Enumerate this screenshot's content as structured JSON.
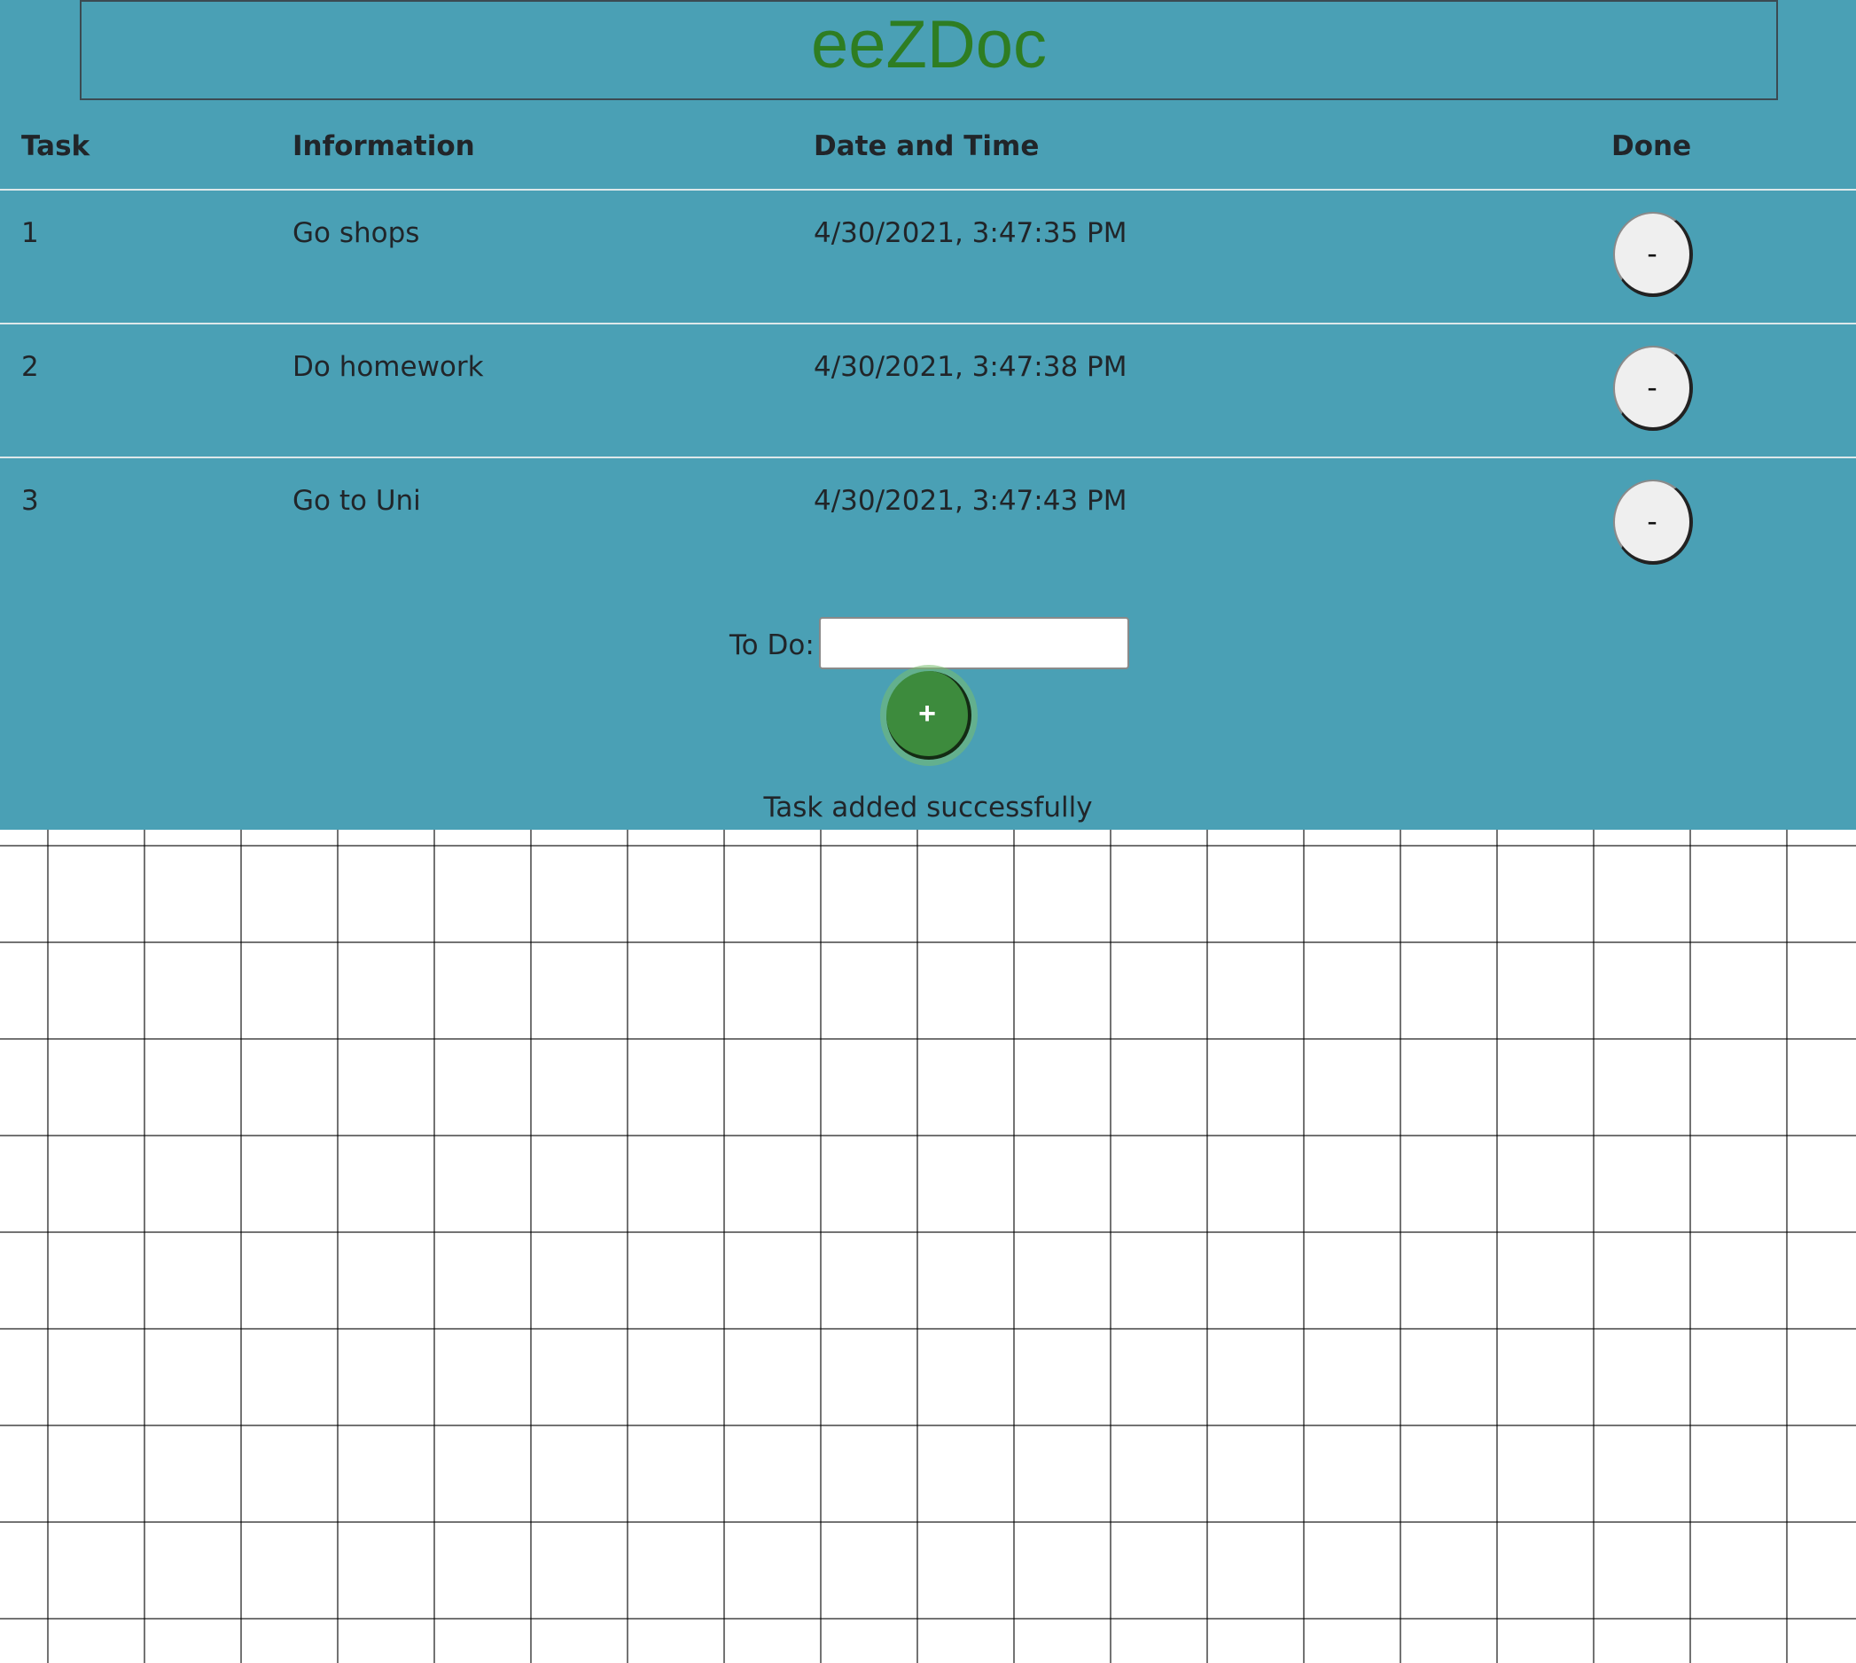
{
  "app": {
    "title": "eeZDoc",
    "panel_color": "#4aa0b5",
    "title_color": "#2e7d22"
  },
  "table": {
    "headers": {
      "task": "Task",
      "information": "Information",
      "date": "Date and Time",
      "done": "Done"
    },
    "rows": [
      {
        "task": "1",
        "information": "Go shops",
        "date": "4/30/2021, 3:47:35 PM",
        "done_label": "-"
      },
      {
        "task": "2",
        "information": "Do homework",
        "date": "4/30/2021, 3:47:38 PM",
        "done_label": "-"
      },
      {
        "task": "3",
        "information": "Go to Uni",
        "date": "4/30/2021, 3:47:43 PM",
        "done_label": "-"
      }
    ]
  },
  "form": {
    "todo_label": "To Do:",
    "todo_value": "",
    "add_label": "+",
    "add_color": "#3d8b3d"
  },
  "status": {
    "message": "Task added successfully"
  }
}
